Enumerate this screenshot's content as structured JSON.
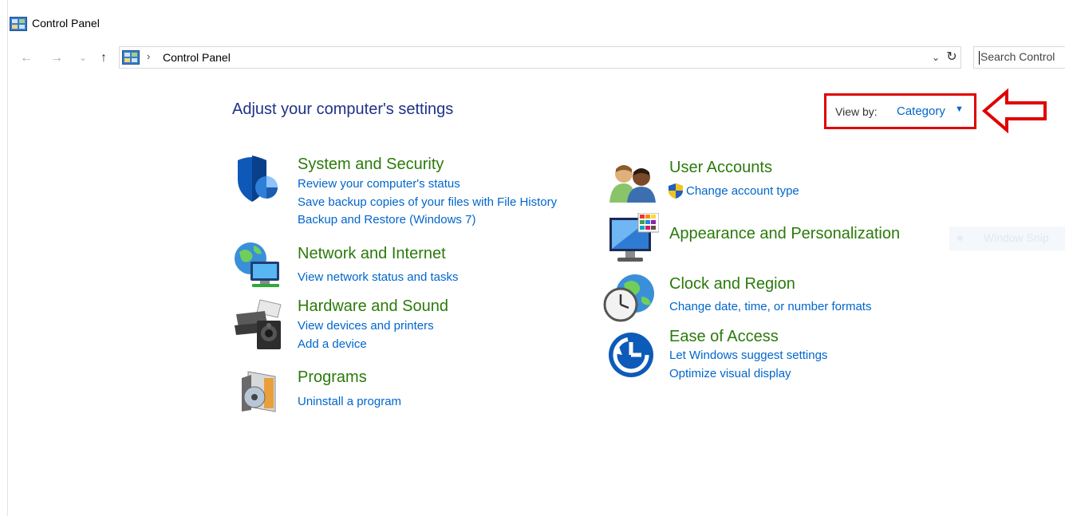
{
  "window": {
    "title": "Control Panel"
  },
  "nav": {
    "back_icon": "back-arrow-icon",
    "forward_icon": "forward-arrow-icon",
    "recent_icon": "chevron-down-icon",
    "up_icon": "up-arrow-icon"
  },
  "address": {
    "separator": "›",
    "crumb": "Control Panel",
    "dropdown_glyph": "⌄",
    "refresh_glyph": "↻"
  },
  "search": {
    "placeholder": "Search Control"
  },
  "main": {
    "title": "Adjust your computer's settings",
    "view_by": {
      "label": "View by:",
      "value": "Category",
      "caret": "▼"
    },
    "categories_left": [
      {
        "title": "System and Security",
        "icon": "shield-icon",
        "links": [
          "Review your computer's status",
          "Save backup copies of your files with File History",
          "Backup and Restore (Windows 7)"
        ]
      },
      {
        "title": "Network and Internet",
        "icon": "network-globe-icon",
        "links": [
          "View network status and tasks"
        ]
      },
      {
        "title": "Hardware and Sound",
        "icon": "printer-speaker-icon",
        "links": [
          "View devices and printers",
          "Add a device"
        ]
      },
      {
        "title": "Programs",
        "icon": "programs-disc-icon",
        "links": [
          "Uninstall a program"
        ]
      }
    ],
    "categories_right": [
      {
        "title": "User Accounts",
        "icon": "users-icon",
        "links": [
          "Change account type"
        ]
      },
      {
        "title": "Appearance and Personalization",
        "icon": "monitor-palette-icon",
        "links": []
      },
      {
        "title": "Clock and Region",
        "icon": "globe-clock-icon",
        "links": [
          "Change date, time, or number formats"
        ]
      },
      {
        "title": "Ease of Access",
        "icon": "ease-of-access-icon",
        "links": [
          "Let Windows suggest settings",
          "Optimize visual display"
        ]
      }
    ]
  },
  "overlay": {
    "snip_text": "Window Snip"
  },
  "colors": {
    "category_title": "#2b7a0b",
    "link": "#0066cc",
    "page_title": "#1e3287",
    "annotation_red": "#e00000"
  }
}
